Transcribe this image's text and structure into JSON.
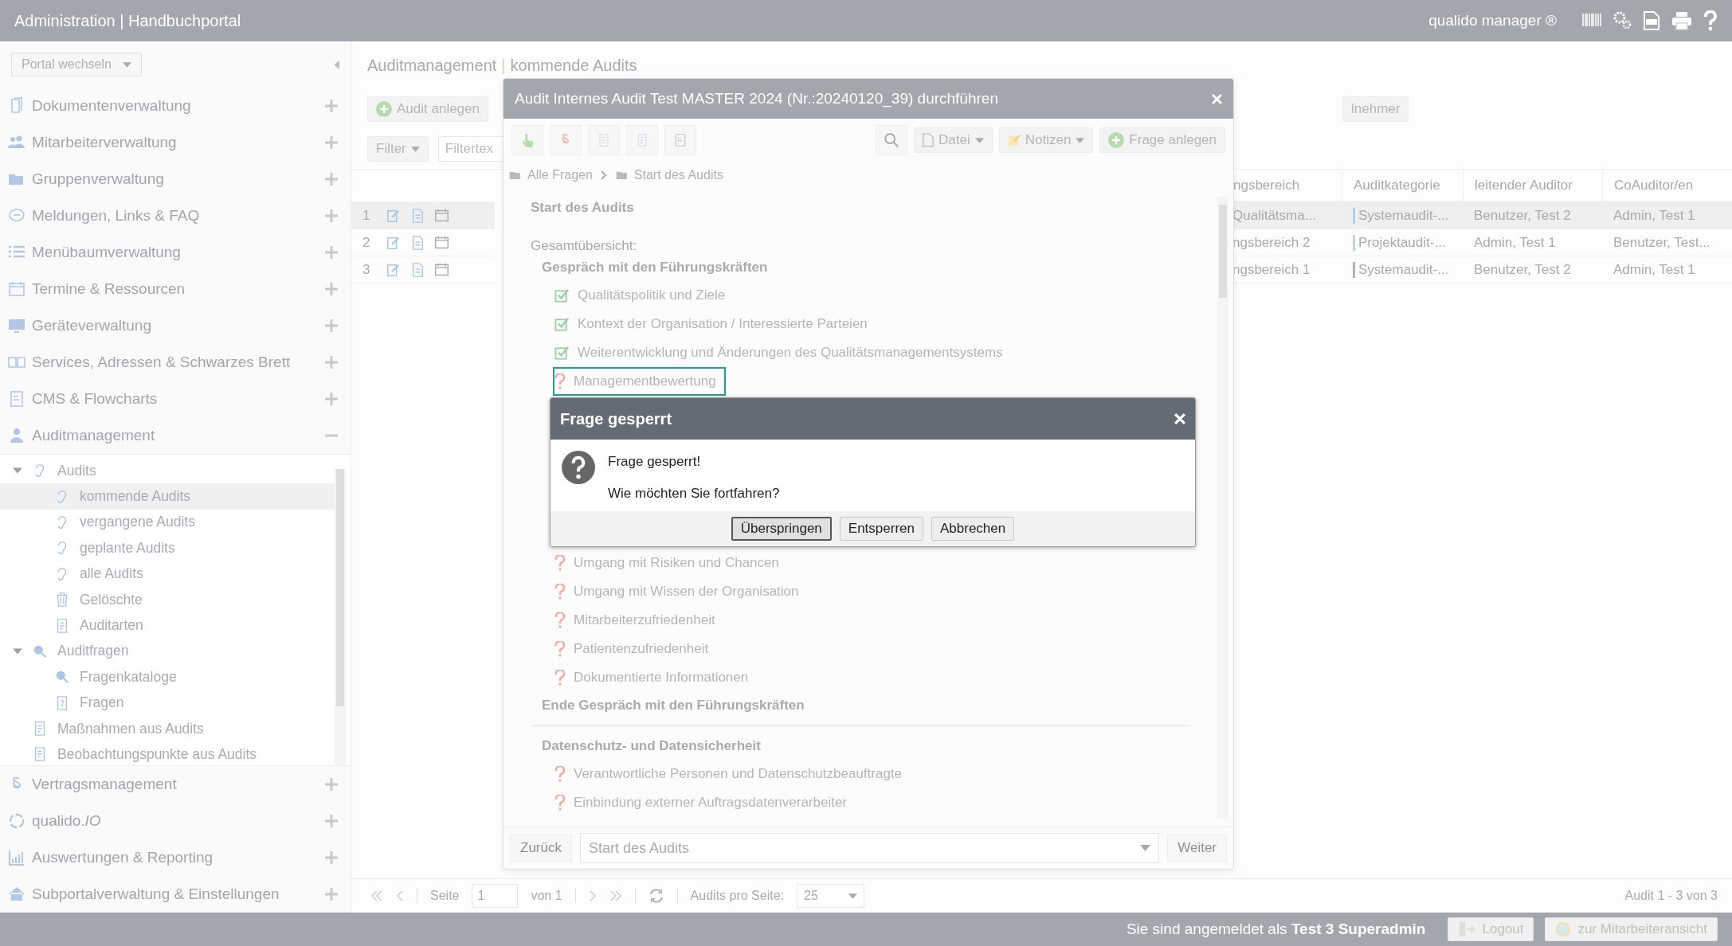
{
  "header": {
    "title": "Administration | Handbuchportal",
    "brand": "qualido manager ®"
  },
  "sidebar": {
    "portal_switch": "Portal wechseln",
    "items": [
      {
        "label": "Dokumentenverwaltung",
        "expanded": false
      },
      {
        "label": "Mitarbeiterverwaltung",
        "expanded": false
      },
      {
        "label": "Gruppenverwaltung",
        "expanded": false
      },
      {
        "label": "Meldungen, Links & FAQ",
        "expanded": false
      },
      {
        "label": "Menübaumverwaltung",
        "expanded": false
      },
      {
        "label": "Termine & Ressourcen",
        "expanded": false
      },
      {
        "label": "Geräteverwaltung",
        "expanded": false
      },
      {
        "label": "Services, Adressen & Schwarzes Brett",
        "expanded": false
      },
      {
        "label": "CMS & Flowcharts",
        "expanded": false
      },
      {
        "label": "Auditmanagement",
        "expanded": true,
        "children": [
          {
            "label": "Audits",
            "expanded": true,
            "selected": false,
            "children": [
              {
                "label": "kommende Audits",
                "selected": true
              },
              {
                "label": "vergangene Audits",
                "selected": false
              },
              {
                "label": "geplante Audits",
                "selected": false
              },
              {
                "label": "alle Audits",
                "selected": false
              },
              {
                "label": "Gelöschte",
                "selected": false
              },
              {
                "label": "Auditarten",
                "selected": false
              }
            ]
          },
          {
            "label": "Auditfragen",
            "expanded": true,
            "selected": false,
            "children": [
              {
                "label": "Fragenkataloge",
                "selected": false
              },
              {
                "label": "Fragen",
                "selected": false
              }
            ]
          },
          {
            "label": "Maßnahmen aus Audits",
            "selected": false
          },
          {
            "label": "Beobachtungspunkte aus Audits",
            "selected": false
          }
        ]
      },
      {
        "label": "Vertragsmanagement",
        "expanded": false
      },
      {
        "label": "qualido.*IO*",
        "expanded": false
      },
      {
        "label": "Auswertungen & Reporting",
        "expanded": false
      },
      {
        "label": "Subportalverwaltung & Einstellungen",
        "expanded": false
      }
    ]
  },
  "main": {
    "breadcrumb": {
      "section": "Auditmanagement",
      "separator": "|",
      "page": "kommende Audits"
    },
    "toolbar": [
      {
        "label": "Audit anlegen"
      },
      {
        "label": "lnehmer"
      }
    ],
    "filter": {
      "label": "Filter",
      "placeholder": "Filtertex"
    },
    "table": {
      "columns": [
        "ngsbereich",
        "Auditkategorie",
        "leitender Auditor",
        "CoAuditor/en"
      ],
      "rows": [
        {
          "number": "1",
          "selected": true,
          "cells": [
            "Qualitätsma...",
            "Systemaudit-...",
            "Benutzer, Test 2",
            "Admin, Test 1"
          ],
          "color": "#a9d5ee"
        },
        {
          "number": "2",
          "selected": false,
          "cells": [
            "ngsbereich 2",
            "Projektaudit-...",
            "Admin, Test 1",
            "Benutzer, Test..."
          ],
          "color": "#b7dfc0"
        },
        {
          "number": "3",
          "selected": false,
          "cells": [
            "ngsbereich 1",
            "Systemaudit-...",
            "Benutzer, Test 2",
            "Admin, Test 1"
          ],
          "color": "#a7b6c6"
        }
      ]
    },
    "pagination": {
      "page_label": "Seite",
      "page": "1",
      "page_count": "von 1",
      "per_page_label": "Audits pro Seite:",
      "per_page": "25",
      "summary": "Audit 1 - 3 von 3"
    }
  },
  "audit_modal": {
    "title": "Audit Internes Audit Test MASTER 2024 (Nr.:20240120_39) durchführen",
    "toolbar": {
      "file": "Datei",
      "notes": "Notizen",
      "add_question": "Frage anlegen"
    },
    "breadcrumb": [
      "Alle Fragen",
      "Start des Audits"
    ],
    "heading": "Start des Audits",
    "overview_label": "Gesamtübersicht:",
    "sections": [
      {
        "title": "Gespräch mit den Führungskräften",
        "items": [
          {
            "label": "Qualitätspolitik und Ziele",
            "kind": "answered",
            "focused": false
          },
          {
            "label": "Kontext der Organisation / Interessierte Parteien",
            "kind": "answered",
            "focused": false
          },
          {
            "label": "Weiterentwicklung und Änderungen des Qualitätsmanagementsystems",
            "kind": "answered",
            "focused": false
          },
          {
            "label": "Managementbewertung",
            "kind": "open",
            "focused": true
          },
          {
            "label": "Umgang mit Risiken und Chancen",
            "kind": "open",
            "focused": false
          },
          {
            "label": "Umgang mit Wissen der Organisation",
            "kind": "open",
            "focused": false
          },
          {
            "label": "Mitarbeiterzufriedenheit",
            "kind": "open",
            "focused": false
          },
          {
            "label": "Patientenzufriedenheit",
            "kind": "open",
            "focused": false
          },
          {
            "label": "Dokumentierte Informationen",
            "kind": "open",
            "focused": false
          }
        ],
        "end_label": "Ende Gespräch mit den Führungskräften"
      },
      {
        "title": "Datenschutz- und Datensicherheit",
        "items": [
          {
            "label": "Verantwortliche Personen und Datenschutzbeauftragte",
            "kind": "open",
            "focused": false
          },
          {
            "label": "Einbindung externer Auftragsdatenverarbeiter",
            "kind": "open",
            "focused": false
          }
        ]
      }
    ],
    "back": {
      "label": "Zurück",
      "disabled": true
    },
    "step_select": "Start des Audits",
    "next": {
      "label": "Weiter",
      "disabled": true
    }
  },
  "dialog": {
    "title": "Frage gesperrt",
    "message": "Frage gesperrt!",
    "question": "Wie möchten Sie fortfahren?",
    "buttons": [
      {
        "label": "Überspringen",
        "selected": true
      },
      {
        "label": "Entsperren",
        "selected": false
      },
      {
        "label": "Abbrechen",
        "selected": false
      }
    ]
  },
  "footer": {
    "login_text": "Sie sind angemeldet als **Test 3 Superadmin**",
    "logout": "Logout",
    "employee_view": "zur Mitarbeiteransicht"
  }
}
